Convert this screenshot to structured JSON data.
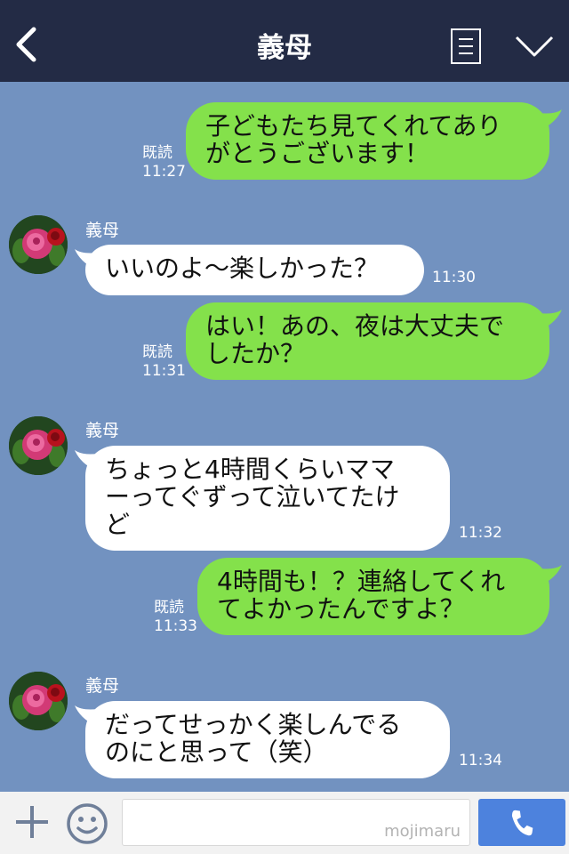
{
  "header": {
    "title": "義母",
    "icons": [
      "back-icon",
      "menu-icon",
      "chevron-down-icon"
    ]
  },
  "messages": [
    {
      "side": "sent",
      "lines": [
        "子どもたち見てくれてあり",
        "がとうございます！"
      ],
      "read": "既読",
      "time": "11:27"
    },
    {
      "side": "received",
      "sender": "義母",
      "lines": [
        "いいのよ～楽しかった？"
      ],
      "time": "11:30"
    },
    {
      "side": "sent",
      "lines": [
        "はい！あの、夜は大丈夫で",
        "したか？"
      ],
      "read": "既読",
      "time": "11:31"
    },
    {
      "side": "received",
      "sender": "義母",
      "lines": [
        "ちょっと4時間くらいママ",
        "ーってぐずって泣いてたけ",
        "ど"
      ],
      "time": "11:32"
    },
    {
      "side": "sent",
      "lines": [
        "4時間も！？連絡してくれ",
        "てよかったんですよ？"
      ],
      "read": "既読",
      "time": "11:33"
    },
    {
      "side": "received",
      "sender": "義母",
      "lines": [
        "だってせっかく楽しんでる",
        "のにと思って（笑）"
      ],
      "time": "11:34"
    }
  ],
  "footer": {
    "watermark": "mojimaru",
    "icons": [
      "plus-icon",
      "smile-icon",
      "phone-icon"
    ]
  },
  "colors": {
    "header_bg": "#232b45",
    "chat_bg": "#7292c0",
    "sent_bubble": "#84e14b",
    "received_bubble": "#ffffff",
    "send_button": "#4d82dd"
  }
}
